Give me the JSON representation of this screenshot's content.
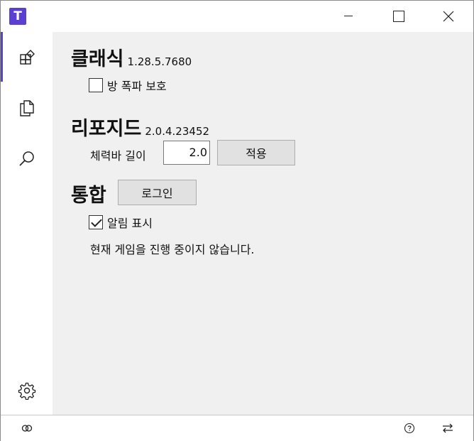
{
  "app": {
    "icon_letter": "T"
  },
  "sidebar": {
    "items": [
      {
        "name": "home",
        "icon": "widgets-icon",
        "active": true
      },
      {
        "name": "copy",
        "icon": "copy-icon",
        "active": false
      },
      {
        "name": "search",
        "icon": "search-icon",
        "active": false
      },
      {
        "name": "settings",
        "icon": "gear-icon",
        "active": false
      }
    ]
  },
  "classic": {
    "title": "클래식",
    "version": "1.28.5.7680",
    "room_protect_label": "방 폭파 보호",
    "room_protect_checked": false
  },
  "reforged": {
    "title": "리포지드",
    "version": "2.0.4.23452",
    "hp_bar_label": "체력바 길이",
    "hp_bar_value": "2.0",
    "apply_label": "적용"
  },
  "integration": {
    "title": "통합",
    "login_label": "로그인",
    "notify_label": "알림 표시",
    "notify_checked": true,
    "status_text": "현재 게임을 진행 중이지 않습니다."
  },
  "bottombar": {
    "icons": [
      "link-icon",
      "help-icon",
      "swap-icon"
    ]
  },
  "colors": {
    "accent": "#5b3fd1",
    "main_bg": "#f0f0f0"
  }
}
